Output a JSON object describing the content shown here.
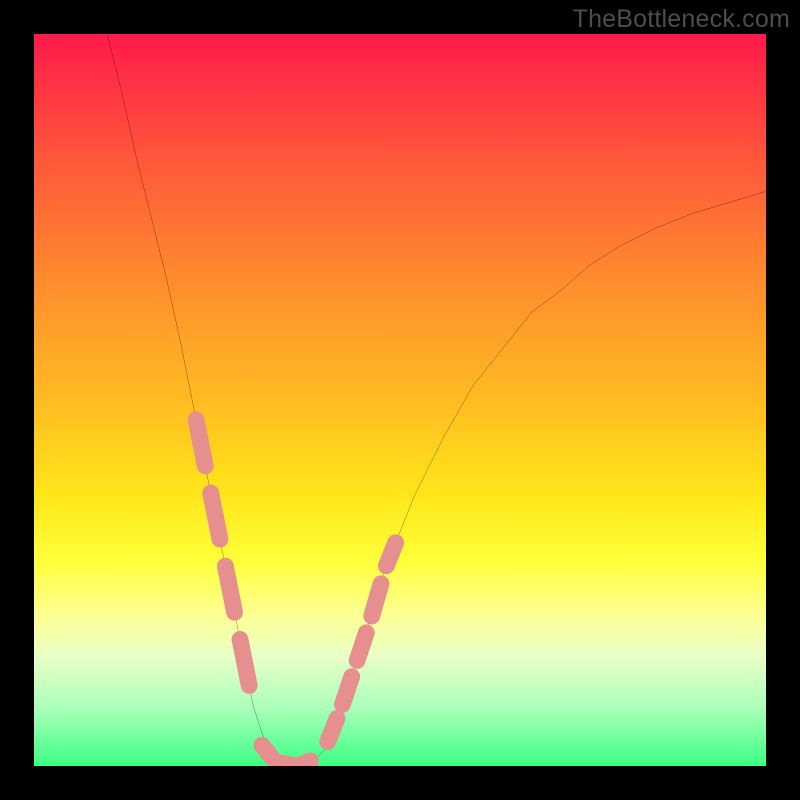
{
  "watermark": "TheBottleneck.com",
  "chart_data": {
    "type": "line",
    "title": "",
    "xlabel": "",
    "ylabel": "",
    "xlim": [
      0,
      100
    ],
    "ylim": [
      0,
      100
    ],
    "grid": false,
    "note": "Axes are unlabeled; values are normalized 0–100 estimates of pixel positions within the plot area.",
    "series": [
      {
        "name": "curve",
        "color": "#000000",
        "x": [
          10.0,
          12.0,
          14.0,
          16.0,
          18.0,
          20.0,
          22.0,
          24.0,
          26.0,
          28.0,
          30.0,
          32.0,
          33.0,
          34.0,
          36.0,
          38.0,
          40.0,
          42.0,
          44.0,
          48.0,
          52.0,
          56.0,
          60.0,
          64.0,
          68.0,
          72.0,
          76.0,
          80.0,
          85.0,
          90.0,
          95.0,
          100.0
        ],
        "y": [
          100.0,
          92.0,
          83.0,
          75.0,
          67.0,
          58.0,
          48.0,
          38.0,
          28.0,
          18.0,
          8.0,
          2.0,
          0.5,
          0.0,
          0.0,
          0.5,
          2.5,
          7.0,
          14.0,
          27.0,
          37.0,
          45.0,
          52.0,
          57.0,
          62.0,
          65.0,
          68.5,
          71.0,
          73.5,
          75.5,
          77.0,
          78.5
        ]
      },
      {
        "name": "highlight-left",
        "color": "#e68f8f",
        "style": "dashed-thick",
        "x": [
          22.0,
          24.0,
          26.0,
          28.0,
          30.0
        ],
        "y": [
          48.0,
          38.0,
          28.0,
          18.0,
          8.0
        ]
      },
      {
        "name": "highlight-bottom",
        "color": "#e68f8f",
        "style": "dashed-thick",
        "x": [
          31.0,
          33.0,
          36.0,
          38.5
        ],
        "y": [
          3.0,
          0.5,
          0.0,
          1.0
        ]
      },
      {
        "name": "highlight-right",
        "color": "#e68f8f",
        "style": "dashed-thick",
        "x": [
          40.0,
          42.0,
          44.0,
          46.0,
          48.0,
          50.0
        ],
        "y": [
          3.0,
          8.0,
          14.0,
          20.0,
          27.0,
          32.0
        ]
      }
    ]
  }
}
